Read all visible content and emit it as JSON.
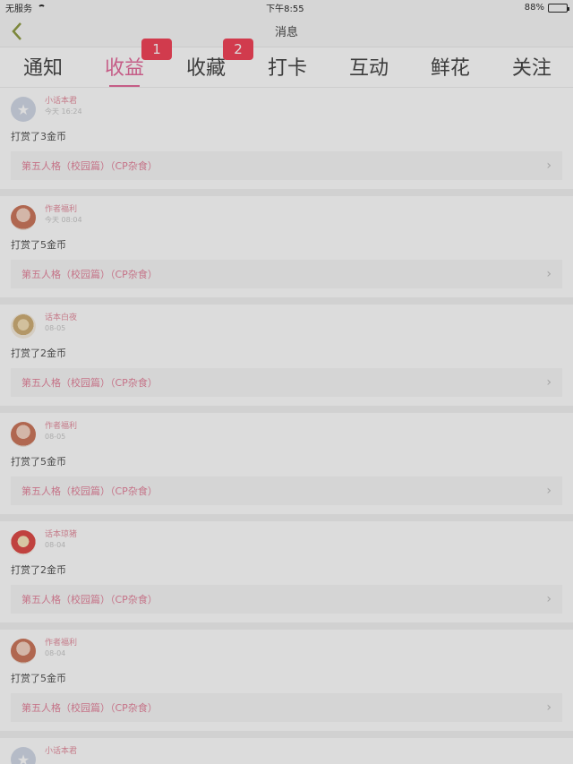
{
  "status_bar": {
    "carrier": "无服务",
    "time": "下午8:55",
    "battery_pct": "88%",
    "battery_level": 0.88
  },
  "nav": {
    "title": "消息"
  },
  "tabs": [
    {
      "label": "通知"
    },
    {
      "label": "收益",
      "active": true,
      "badge": "1"
    },
    {
      "label": "收藏",
      "badge": "2"
    },
    {
      "label": "打卡"
    },
    {
      "label": "互动"
    },
    {
      "label": "鲜花"
    },
    {
      "label": "关注"
    }
  ],
  "items": [
    {
      "user": "小话本君",
      "time": "今天 16:24",
      "action": "打赏了3金币",
      "book": "第五人格（校园篇）（CP杂食）",
      "avatar": "gray"
    },
    {
      "user": "作者福利",
      "time": "今天 08:04",
      "action": "打赏了5金币",
      "book": "第五人格（校园篇）（CP杂食）",
      "avatar": "girl"
    },
    {
      "user": "话本白夜",
      "time": "08-05",
      "action": "打赏了2金币",
      "book": "第五人格（校园篇）（CP杂食）",
      "avatar": "chef"
    },
    {
      "user": "作者福利",
      "time": "08-05",
      "action": "打赏了5金币",
      "book": "第五人格（校园篇）（CP杂食）",
      "avatar": "girl"
    },
    {
      "user": "话本琼猪",
      "time": "08-04",
      "action": "打赏了2金币",
      "book": "第五人格（校园篇）（CP杂食）",
      "avatar": "red"
    },
    {
      "user": "作者福利",
      "time": "08-04",
      "action": "打赏了5金币",
      "book": "第五人格（校园篇）（CP杂食）",
      "avatar": "girl"
    }
  ],
  "partial_item": {
    "user": "小话本君",
    "avatar": "gray"
  },
  "colors": {
    "accent": "#e0508a",
    "badge": "#f0203a",
    "book_text": "#e06d8a"
  }
}
